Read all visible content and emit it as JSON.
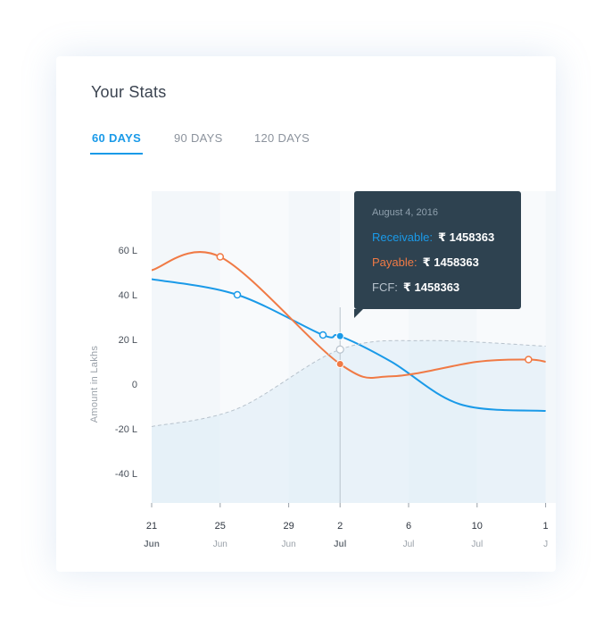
{
  "header": {
    "title": "Your Stats"
  },
  "tabs": [
    {
      "label": "60 DAYS",
      "active": true
    },
    {
      "label": "90 DAYS",
      "active": false
    },
    {
      "label": "120 DAYS",
      "active": false
    }
  ],
  "tooltip": {
    "date": "August 4, 2016",
    "rows": [
      {
        "label": "Receivable:",
        "value": "₹ 1458363",
        "color": "#1a9ae8"
      },
      {
        "label": "Payable:",
        "value": "₹ 1458363",
        "color": "#f07a45"
      },
      {
        "label": "FCF:",
        "value": "₹ 1458363",
        "color": "#b7c2cc"
      }
    ]
  },
  "chart_data": {
    "type": "line",
    "ylabel": "Amount in Lakhs",
    "ylim": [
      -50,
      80
    ],
    "yticks": [
      {
        "value": 60,
        "label": "60 L"
      },
      {
        "value": 40,
        "label": "40 L"
      },
      {
        "value": 20,
        "label": "20 L"
      },
      {
        "value": 0,
        "label": "0"
      },
      {
        "value": -20,
        "label": "-20 L"
      },
      {
        "value": -40,
        "label": "-40 L"
      }
    ],
    "x_start": "2016-06-21",
    "xticks": [
      {
        "day": "21",
        "month": "Jun",
        "date": "2016-06-21"
      },
      {
        "day": "25",
        "month": "Jun",
        "date": "2016-06-25"
      },
      {
        "day": "29",
        "month": "Jun",
        "date": "2016-06-29"
      },
      {
        "day": "2",
        "month": "Jul",
        "date": "2016-07-02"
      },
      {
        "day": "6",
        "month": "Jul",
        "date": "2016-07-06"
      },
      {
        "day": "10",
        "month": "Jul",
        "date": "2016-07-10"
      },
      {
        "day": "1",
        "month": "J",
        "date": "2016-07-14"
      }
    ],
    "highlight_date": "2016-07-02",
    "series": [
      {
        "name": "Receivable",
        "color": "#1a9ae8",
        "dashed": false,
        "points": [
          [
            "2016-06-21",
            47
          ],
          [
            "2016-06-26",
            40
          ],
          [
            "2016-07-01",
            22
          ],
          [
            "2016-07-02",
            21.5
          ],
          [
            "2016-07-05",
            10
          ],
          [
            "2016-07-09",
            -9
          ],
          [
            "2016-07-14",
            -12
          ]
        ],
        "markers": [
          "2016-06-26",
          "2016-07-01"
        ]
      },
      {
        "name": "Payable",
        "color": "#f07a45",
        "dashed": false,
        "points": [
          [
            "2016-06-21",
            51
          ],
          [
            "2016-06-25",
            57
          ],
          [
            "2016-07-02",
            9
          ],
          [
            "2016-07-05",
            3.5
          ],
          [
            "2016-07-10",
            10
          ],
          [
            "2016-07-13",
            11
          ],
          [
            "2016-07-14",
            10
          ]
        ],
        "markers": [
          "2016-06-25",
          "2016-07-13"
        ]
      },
      {
        "name": "FCF",
        "color": "#b7c2cc",
        "dashed": true,
        "points": [
          [
            "2016-06-21",
            -19
          ],
          [
            "2016-06-26",
            -11
          ],
          [
            "2016-07-02",
            15.5
          ],
          [
            "2016-07-07",
            19.5
          ],
          [
            "2016-07-14",
            17
          ]
        ],
        "markers": []
      }
    ],
    "grid": false,
    "legend": "none"
  }
}
